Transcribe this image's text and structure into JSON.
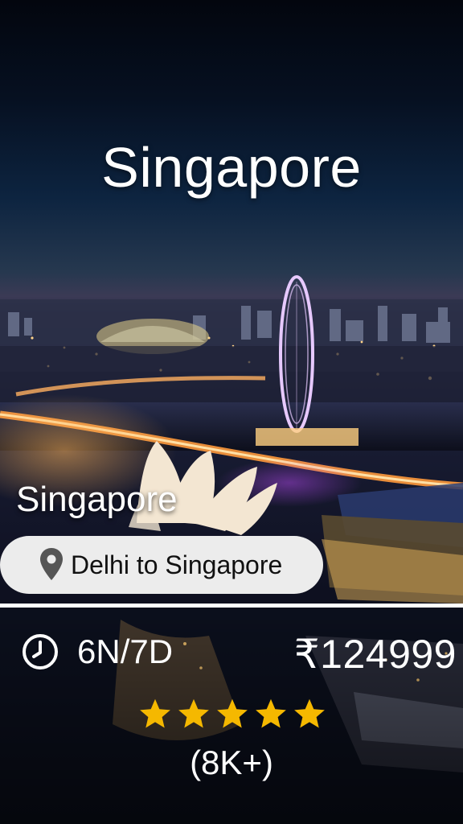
{
  "hero": {
    "title": "Singapore"
  },
  "package": {
    "destination": "Singapore",
    "route": "Delhi to Singapore",
    "duration": "6N/7D",
    "price": "₹124999",
    "rating": 5,
    "rating_max": 5,
    "reviews": "(8K+)"
  },
  "icons": {
    "location": "map-pin-icon",
    "duration": "clock-icon",
    "rating": "star-icon"
  },
  "colors": {
    "star": "#f5b800",
    "pill_bg": "#ececec",
    "sky_top": "#050a18",
    "city_lights": "#ffb347"
  }
}
